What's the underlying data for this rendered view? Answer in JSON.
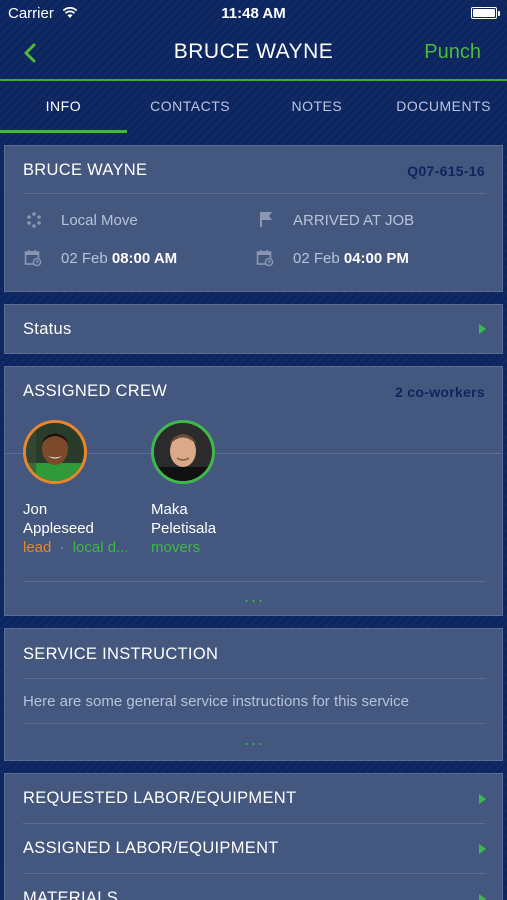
{
  "status_bar": {
    "carrier": "Carrier",
    "time": "11:48 AM"
  },
  "navbar": {
    "title": "BRUCE WAYNE",
    "action_label": "Punch",
    "back_icon": "chevron-left-icon"
  },
  "tabs": [
    {
      "label": "INFO",
      "active": true
    },
    {
      "label": "CONTACTS",
      "active": false
    },
    {
      "label": "NOTES",
      "active": false
    },
    {
      "label": "DOCUMENTS",
      "active": false
    }
  ],
  "job": {
    "customer": "BRUCE WAYNE",
    "job_id": "Q07-615-16",
    "move_type": "Local Move",
    "job_status": "ARRIVED AT JOB",
    "start_date": "02 Feb",
    "start_time": "08:00 AM",
    "end_date": "02 Feb",
    "end_time": "04:00 PM"
  },
  "status_row": {
    "label": "Status"
  },
  "crew": {
    "title": "ASSIGNED CREW",
    "count": "2 co-workers",
    "members": [
      {
        "first": "Jon",
        "last": "Appleseed",
        "role1": "lead",
        "separator": "·",
        "role2": "local d...",
        "ring": "#e8862a"
      },
      {
        "first": "Maka",
        "last": "Peletisala",
        "role1": "movers",
        "ring": "#3fb84a"
      }
    ],
    "more": "..."
  },
  "service": {
    "title": "SERVICE INSTRUCTION",
    "text": "Here are some general service instructions for this service",
    "more": "..."
  },
  "links": [
    {
      "label": "REQUESTED LABOR/EQUIPMENT"
    },
    {
      "label": "ASSIGNED LABOR/EQUIPMENT"
    },
    {
      "label": "MATERIALS"
    }
  ],
  "colors": {
    "accent_green": "#3fb84a",
    "lead_orange": "#e8862a",
    "background": "#0d2660",
    "card": "#44577e"
  }
}
